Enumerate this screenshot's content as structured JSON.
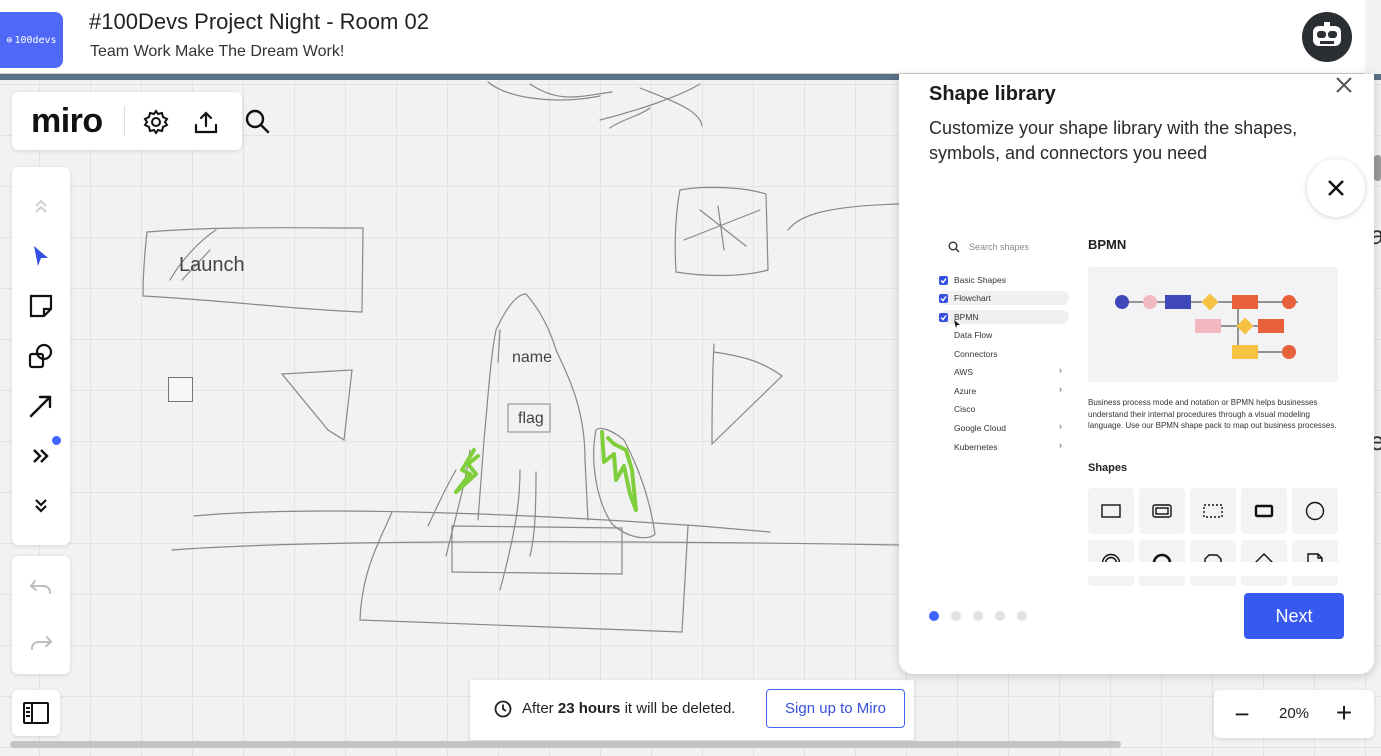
{
  "topbar": {
    "logo_text": "100devs",
    "room_title": "#100Devs Project Night - Room 02",
    "room_subtitle": "Team Work Make The Dream Work!",
    "avatar_icon": "robot-avatar-icon"
  },
  "brand": {
    "name": "miro"
  },
  "canvas": {
    "launch_label": "Launch",
    "name_label": "name",
    "flag_label": "flag",
    "edge_letters": [
      "a",
      "e"
    ]
  },
  "toolbar_icons": [
    "settings-icon",
    "export-icon",
    "search-icon",
    "collapse-up-icon",
    "select-cursor-icon",
    "sticky-note-icon",
    "shapes-icon",
    "pen-arrow-icon",
    "more-tools-icon",
    "expand-down-icon",
    "undo-icon",
    "redo-icon",
    "board-list-icon"
  ],
  "notice": {
    "prefix": "After",
    "duration": "23 hours",
    "suffix": "it will be deleted.",
    "signup_label": "Sign up to Miro"
  },
  "zoom": {
    "value": "20%",
    "minus": "−",
    "plus": "+"
  },
  "panel": {
    "title": "Shape library",
    "description": "Customize your shape library with the shapes, symbols, and connectors you need",
    "preview": {
      "search_placeholder": "Search shapes",
      "items": [
        {
          "label": "Basic Shapes",
          "checked": true,
          "chevron": false
        },
        {
          "label": "Flowchart",
          "checked": true,
          "chevron": false
        },
        {
          "label": "BPMN",
          "checked": true,
          "chevron": false
        },
        {
          "label": "Data Flow",
          "checked": false,
          "chevron": false
        },
        {
          "label": "Connectors",
          "checked": false,
          "chevron": false
        },
        {
          "label": "AWS",
          "checked": false,
          "chevron": true
        },
        {
          "label": "Azure",
          "checked": false,
          "chevron": true
        },
        {
          "label": "Cisco",
          "checked": false,
          "chevron": false
        },
        {
          "label": "Google Cloud",
          "checked": false,
          "chevron": true
        },
        {
          "label": "Kubernetes",
          "checked": false,
          "chevron": true
        }
      ],
      "heading": "BPMN",
      "paragraph": "Business process mode and notation or BPMN helps businesses understand their internal procedures through a visual modeling language. Use our BPMN shape pack to map out business processes.",
      "shapes_heading": "Shapes"
    },
    "pages_total": 5,
    "active_page": 1,
    "next_label": "Next"
  },
  "colors": {
    "accent": "#4262ff",
    "next_button": "#3859f0",
    "logo_badge": "#4f68f7",
    "bpmn_blue": "#3f48b8",
    "bpmn_pink": "#f2b8c0",
    "bpmn_yellow": "#f5c242",
    "bpmn_orange": "#e8603c",
    "doodle_green": "#7fcf3d"
  }
}
